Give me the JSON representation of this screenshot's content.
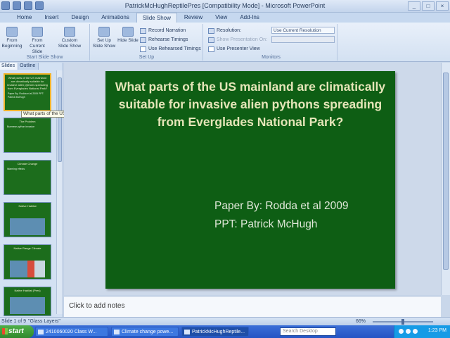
{
  "window": {
    "title": "PatrickMcHughReptilePres [Compatibility Mode] - Microsoft PowerPoint",
    "controls": {
      "minimize": "_",
      "maximize": "□",
      "close": "×"
    }
  },
  "ribbon": {
    "tabs": [
      "Home",
      "Insert",
      "Design",
      "Animations",
      "Slide Show",
      "Review",
      "View",
      "Add-Ins"
    ],
    "active_tab": "Slide Show",
    "start_slide_show": {
      "label": "Start Slide Show",
      "from_beginning": "From Beginning",
      "from_current": "From Current Slide",
      "custom": "Custom Slide Show"
    },
    "set_up": {
      "label": "Set Up",
      "set_up_slide_show": "Set Up Slide Show",
      "hide_slide": "Hide Slide",
      "record_narration": "Record Narration",
      "rehearse_timings": "Rehearse Timings",
      "use_rehearsed_timings": "Use Rehearsed Timings"
    },
    "monitors": {
      "label": "Monitors",
      "resolution": "Resolution:",
      "resolution_value": "Use Current Resolution",
      "show_presentation_on": "Show Presentation On:",
      "use_presenter_view": "Use Presenter View"
    }
  },
  "left_pane": {
    "tabs": [
      "Slides",
      "Outline"
    ],
    "tooltip": "What parts of the US mainland ...",
    "thumbnails": [
      {
        "title": "What parts of the US mainland are climatically suitable for invasive alien pythons spreading from Everglades National Park?",
        "body": "Paper By: Rodda et al 2009 PPT: Patrick McHugh"
      },
      {
        "title": "The Problem",
        "body": "Burmese python invasive"
      },
      {
        "title": "Climate Change",
        "body": "Warming effects"
      },
      {
        "title": "Native Habitat",
        "body": ""
      },
      {
        "title": "Native Range Climate",
        "body": ""
      },
      {
        "title": "Native Habitat (Pres)",
        "body": ""
      }
    ]
  },
  "slide": {
    "title": "What parts of the US mainland are climatically suitable for invasive alien pythons spreading from Everglades National Park?",
    "author_line": "Paper By: Rodda et al 2009",
    "ppt_line": "PPT: Patrick McHugh"
  },
  "notes": {
    "placeholder": "Click to add notes"
  },
  "status": {
    "slide_info": "Slide 1 of 9",
    "theme": "\"Glass Layers\"",
    "zoom": "66%"
  },
  "taskbar": {
    "start": "start",
    "items": [
      "2410060020 Class W...",
      "Climate change powe...",
      "PatrickMcHughReptile..."
    ],
    "search_placeholder": "Search Desktop",
    "clock": "1:23 PM"
  },
  "colors": {
    "slide_bg": "#0e5e14",
    "slide_title": "#e5e5b8",
    "ribbon": "#d3e1f2",
    "taskbar": "#2454c4"
  }
}
